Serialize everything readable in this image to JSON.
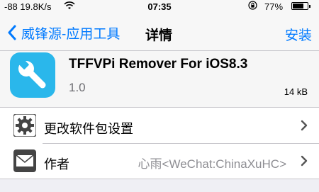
{
  "status_bar": {
    "signal": "-88 19.8K/s",
    "time": "07:35",
    "battery_percent": "77%",
    "battery_level": 0.77
  },
  "nav": {
    "back_label": "威锋源-应用工具",
    "title": "详情",
    "action_label": "安装"
  },
  "package": {
    "name": "TFFVPi Remover For iOS8.3",
    "version": "1.0",
    "size": "14 kB",
    "icon_name": "wrench-icon",
    "icon_color": "#2ab7eb"
  },
  "rows": [
    {
      "icon_name": "gear-icon",
      "label": "更改软件包设置",
      "value": ""
    },
    {
      "icon_name": "mail-icon",
      "label": "作者",
      "value": "心雨<WeChat:ChinaXuHC>"
    }
  ],
  "colors": {
    "accent": "#007aff",
    "background": "#efeff4"
  }
}
